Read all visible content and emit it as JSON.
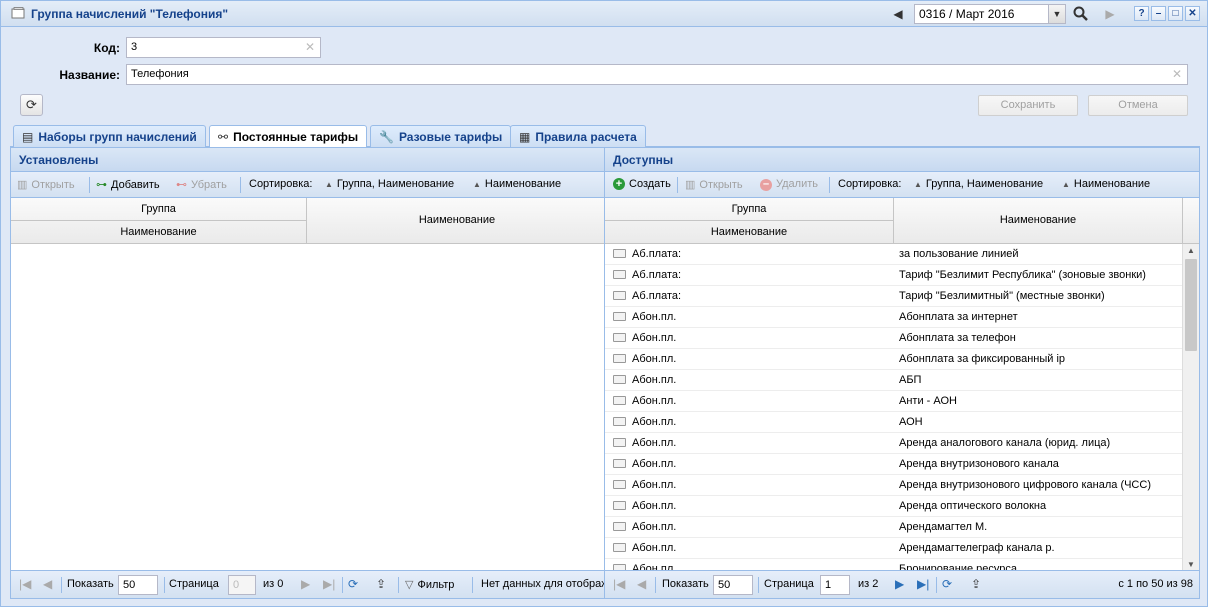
{
  "window": {
    "title": "Группа начислений \"Телефония\"",
    "period": "0316 / Март 2016"
  },
  "form": {
    "code_label": "Код:",
    "code_value": "3",
    "name_label": "Название:",
    "name_value": "Телефония",
    "save_label": "Сохранить",
    "cancel_label": "Отмена"
  },
  "tabs": [
    {
      "label": "Наборы групп начислений",
      "icon": "list-icon"
    },
    {
      "label": "Постоянные тарифы",
      "icon": "link-icon"
    },
    {
      "label": "Разовые тарифы",
      "icon": "wrench-icon"
    },
    {
      "label": "Правила расчета",
      "icon": "calculator-icon"
    }
  ],
  "left": {
    "title": "Установлены",
    "toolbar": {
      "open": "Открыть",
      "add": "Добавить",
      "remove": "Убрать",
      "sort": "Сортировка:",
      "sort1": "Группа, Наименование",
      "sort2": "Наименование"
    },
    "columns": {
      "group": "Группа",
      "sub_name": "Наименование",
      "name": "Наименование"
    },
    "paging": {
      "show": "Показать",
      "page_size": "50",
      "page": "Страница",
      "page_value": "0",
      "of": "из 0",
      "filter": "Фильтр",
      "status": "Нет данных для отображения"
    }
  },
  "right": {
    "title": "Доступны",
    "toolbar": {
      "create": "Создать",
      "open": "Открыть",
      "delete": "Удалить",
      "sort": "Сортировка:",
      "sort1": "Группа, Наименование",
      "sort2": "Наименование"
    },
    "columns": {
      "group": "Группа",
      "sub_name": "Наименование",
      "name": "Наименование"
    },
    "rows": [
      {
        "group": "Аб.плата:",
        "name": "за пользование линией"
      },
      {
        "group": "Аб.плата:",
        "name": "Тариф \"Безлимит Республика\" (зоновые звонки)"
      },
      {
        "group": "Аб.плата:",
        "name": "Тариф \"Безлимитный\" (местные звонки)"
      },
      {
        "group": "Абон.пл.",
        "name": "Абонплата за интернет"
      },
      {
        "group": "Абон.пл.",
        "name": "Абонплата за телефон"
      },
      {
        "group": "Абон.пл.",
        "name": "Абонплата за фиксированный ip"
      },
      {
        "group": "Абон.пл.",
        "name": "АБП"
      },
      {
        "group": "Абон.пл.",
        "name": "Анти - АОН"
      },
      {
        "group": "Абон.пл.",
        "name": "АОН"
      },
      {
        "group": "Абон.пл.",
        "name": "Аренда аналогового канала (юрид. лица)"
      },
      {
        "group": "Абон.пл.",
        "name": "Аренда внутризонового канала"
      },
      {
        "group": "Абон.пл.",
        "name": "Аренда внутризонового цифрового канала (ЧСС)"
      },
      {
        "group": "Абон.пл.",
        "name": "Аренда оптического волокна"
      },
      {
        "group": "Абон.пл.",
        "name": "Арендамагтел М."
      },
      {
        "group": "Абон.пл.",
        "name": "Арендамагтелеграф канала р."
      },
      {
        "group": "Абон.пл.",
        "name": "Бронирование ресурса"
      }
    ],
    "paging": {
      "show": "Показать",
      "page_size": "50",
      "page": "Страница",
      "page_value": "1",
      "of": "из 2",
      "summary": "с 1 по 50 из 98"
    }
  }
}
